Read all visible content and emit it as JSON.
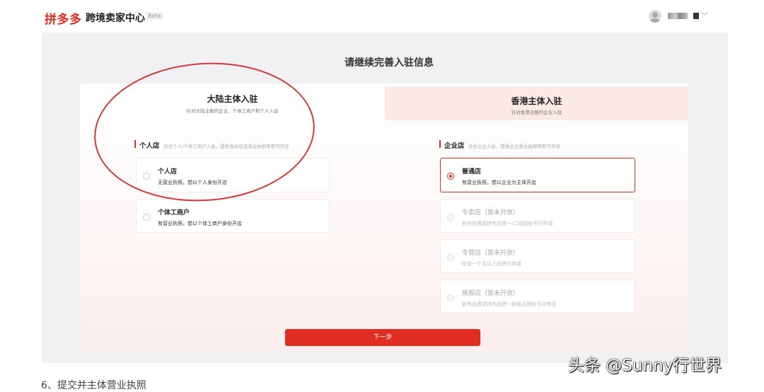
{
  "header": {
    "logo_text": "拼多多",
    "brand_title": "跨境卖家中心",
    "beta_badge": "Beta",
    "user_icon": "user-avatar-icon",
    "dropdown_icon": "chevron-down-icon"
  },
  "main": {
    "page_title": "请继续完善入驻信息",
    "tabs": [
      {
        "label": "大陆主体入驻",
        "desc": "针对大陆注册的企业、个体工商户和个人入驻"
      },
      {
        "label": "香港主体入驻",
        "desc": "针对香港注册的企业入驻"
      }
    ],
    "personal_section": {
      "title": "个人店",
      "desc": "适合个人/个体工商户入驻，提供身份证或营业执照等即可开店",
      "options": [
        {
          "title": "个人店",
          "desc": "无营业执照，想以个人身份开店"
        },
        {
          "title": "个体工商户",
          "desc": "有营业执照，想以个体工商户身份开店"
        }
      ]
    },
    "enterprise_section": {
      "title": "企业店",
      "desc": "适合企业入驻，提供企业营业执照等即可开店",
      "options": [
        {
          "title": "普通店",
          "desc": "有营业执照，想以企业为主体开店",
          "selected": true
        },
        {
          "title": "专卖店（暂未开放）",
          "desc": "自有品牌或持有品牌一/二级授权书可申请"
        },
        {
          "title": "专营店（暂未开放）",
          "desc": "经营一个及以上品牌可申请"
        },
        {
          "title": "旗舰店（暂未开放）",
          "desc": "自有品牌或持有品牌一级独占授权书可申请"
        }
      ]
    },
    "next_button": "下一步"
  },
  "watermark": "头条 @Sunny行世界",
  "bottom_text": "6、提交并主体营业执照",
  "colors": {
    "accent": "#e02e24",
    "annotation": "#d23a3a"
  }
}
